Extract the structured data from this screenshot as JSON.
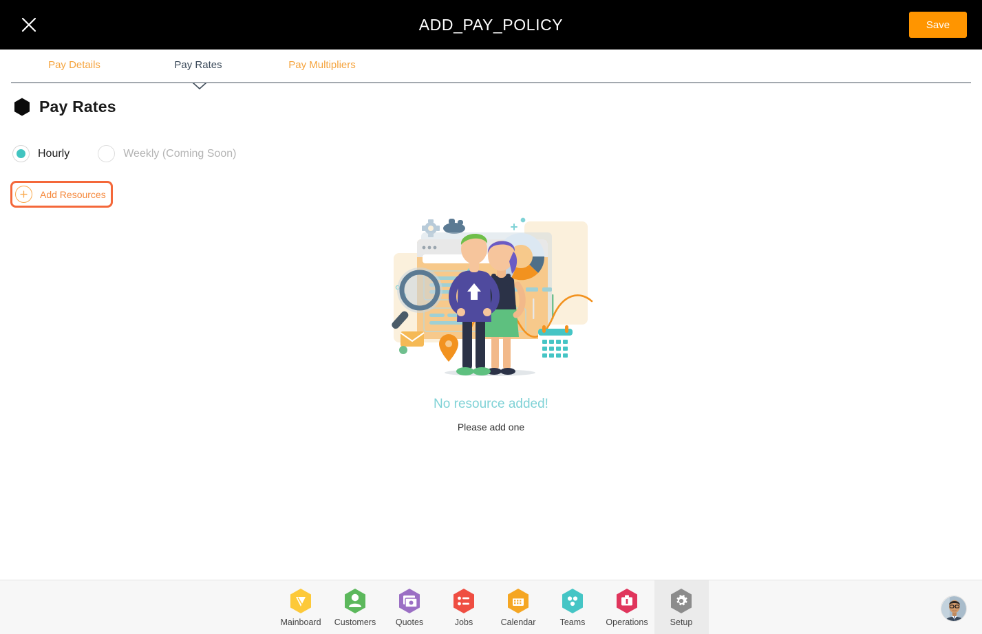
{
  "header": {
    "title": "ADD_PAY_POLICY",
    "close_icon": "close-icon",
    "save_label": "Save",
    "save_color": "#FF9500",
    "background": "#000000"
  },
  "tabs": {
    "items": [
      {
        "label": "Pay Details",
        "active": false
      },
      {
        "label": "Pay Rates",
        "active": true
      },
      {
        "label": "Pay Multipliers",
        "active": false
      }
    ],
    "inactive_color": "#F5A33C",
    "active_color": "#3B4A5A"
  },
  "section": {
    "bullet_icon": "hexagon-icon",
    "title": "Pay Rates"
  },
  "rate_type": {
    "options": [
      {
        "label": "Hourly",
        "selected": true,
        "disabled": false
      },
      {
        "label": "Weekly (Coming Soon)",
        "selected": false,
        "disabled": true
      }
    ],
    "selected_color": "#41C4C0"
  },
  "add_resources": {
    "label": "Add Resources",
    "icon": "plus-circle-icon",
    "text_color": "#F5873A",
    "highlight_color": "#F4683A"
  },
  "empty_state": {
    "illustration": "team-analytics-illustration",
    "title": "No resource added!",
    "title_color": "#7FD2D6",
    "subtitle": "Please add one"
  },
  "bottom_nav": {
    "items": [
      {
        "label": "Mainboard",
        "icon": "mainboard-icon",
        "color": "#FDC939",
        "active": false
      },
      {
        "label": "Customers",
        "icon": "customers-icon",
        "color": "#5CB85C",
        "active": false
      },
      {
        "label": "Quotes",
        "icon": "quotes-icon",
        "color": "#9B6FC4",
        "active": false
      },
      {
        "label": "Jobs",
        "icon": "jobs-icon",
        "color": "#EF4E42",
        "active": false
      },
      {
        "label": "Calendar",
        "icon": "calendar-icon",
        "color": "#F5A623",
        "active": false
      },
      {
        "label": "Teams",
        "icon": "teams-icon",
        "color": "#45C5C5",
        "active": false
      },
      {
        "label": "Operations",
        "icon": "operations-icon",
        "color": "#E0355C",
        "active": false
      },
      {
        "label": "Setup",
        "icon": "setup-gear-icon",
        "color": "#8C8C8C",
        "active": true
      }
    ],
    "background": "#f7f7f7",
    "active_background": "#ebebeb"
  },
  "user": {
    "avatar_icon": "user-avatar"
  }
}
